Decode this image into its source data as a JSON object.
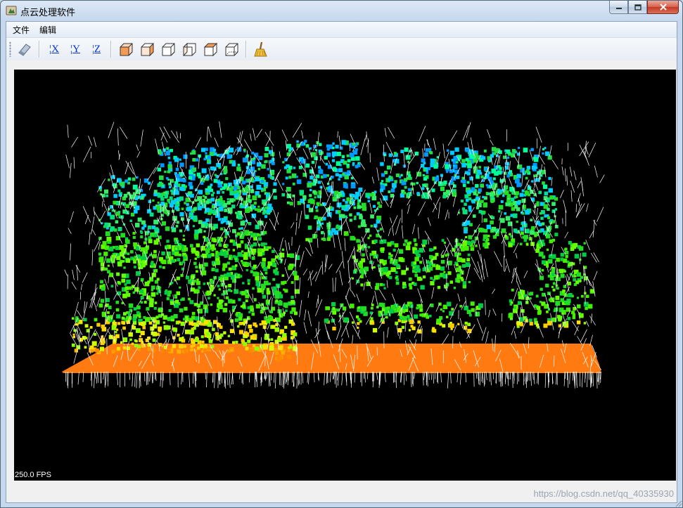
{
  "window": {
    "title": "点云处理软件",
    "icon": "app-icon",
    "controls": [
      "minimize-icon",
      "maximize-icon",
      "close-icon"
    ]
  },
  "menu": {
    "items": [
      "文件",
      "编辑"
    ]
  },
  "toolbar": {
    "buttons": [
      {
        "name": "eraser-button",
        "icon": "eraser-icon"
      },
      {
        "name": "view-x-button",
        "label": "X"
      },
      {
        "name": "view-y-button",
        "label": "Y"
      },
      {
        "name": "view-z-button",
        "label": "Z"
      },
      {
        "name": "view-front-button",
        "icon": "cube-front-icon"
      },
      {
        "name": "view-back-button",
        "icon": "cube-back-icon"
      },
      {
        "name": "view-left-button",
        "icon": "cube-left-icon"
      },
      {
        "name": "view-right-button",
        "icon": "cube-right-icon"
      },
      {
        "name": "view-top-button",
        "icon": "cube-top-icon"
      },
      {
        "name": "view-bottom-button",
        "icon": "cube-bottom-icon"
      },
      {
        "name": "clear-button",
        "icon": "broom-icon"
      }
    ]
  },
  "viewport": {
    "background": "#000000",
    "fps_text": "250.0 FPS"
  },
  "watermark": "https://blog.csdn.net/qq_40335930"
}
